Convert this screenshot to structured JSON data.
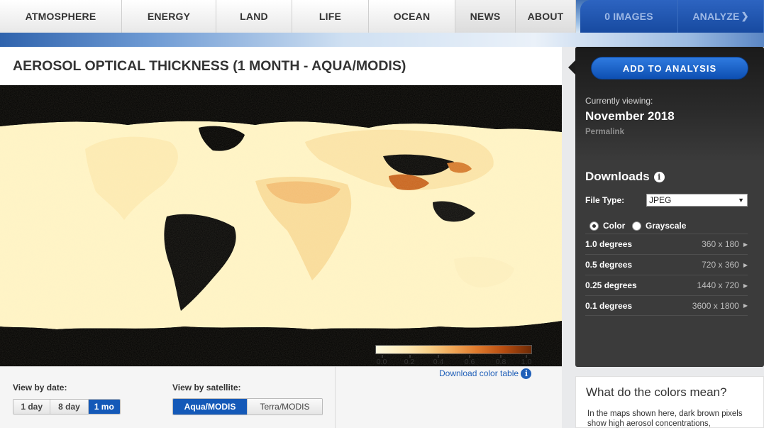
{
  "nav": {
    "tabs": [
      {
        "label": "ATMOSPHERE"
      },
      {
        "label": "ENERGY"
      },
      {
        "label": "LAND"
      },
      {
        "label": "LIFE"
      },
      {
        "label": "OCEAN"
      },
      {
        "label": "NEWS"
      },
      {
        "label": "ABOUT"
      },
      {
        "label": "0 IMAGES"
      },
      {
        "label": "ANALYZE"
      }
    ]
  },
  "main": {
    "title": "AEROSOL OPTICAL THICKNESS (1 MONTH - AQUA/MODIS)",
    "view_by_date_label": "View by date:",
    "date_buttons": [
      "1 day",
      "8 day",
      "1 mo"
    ],
    "date_selected": "1 mo",
    "view_by_satellite_label": "View by satellite:",
    "satellite_buttons": [
      "Aqua/MODIS",
      "Terra/MODIS"
    ],
    "satellite_selected": "Aqua/MODIS",
    "legend": {
      "ticks": [
        "0.0",
        "0.2",
        "0.4",
        "0.6",
        "0.8",
        "1.0"
      ],
      "colors": [
        "#fffbe0",
        "#fde9b5",
        "#f8cf86",
        "#f0a555",
        "#e07a2c",
        "#b84d10",
        "#6e2a05"
      ]
    },
    "download_color_table": "Download color table"
  },
  "sidebar": {
    "add_button": "ADD TO ANALYSIS",
    "currently_viewing_label": "Currently viewing:",
    "currently_viewing_value": "November 2018",
    "permalink": "Permalink",
    "downloads_title": "Downloads",
    "file_type_label": "File Type:",
    "file_type_value": "JPEG",
    "color_option": "Color",
    "grayscale_option": "Grayscale",
    "color_mode_selected": "Color",
    "resolutions": [
      {
        "name": "1.0 degrees",
        "size": "360 x 180"
      },
      {
        "name": "0.5 degrees",
        "size": "720 x 360"
      },
      {
        "name": "0.25 degrees",
        "size": "1440 x 720"
      },
      {
        "name": "0.1 degrees",
        "size": "3600 x 1800"
      }
    ]
  },
  "help": {
    "title": "What do the colors mean?",
    "body": "In the maps shown here, dark brown pixels show high aerosol concentrations,"
  },
  "colors": {
    "accent_blue": "#1459b8",
    "sidebar_bg": "#3b3b3b",
    "map_bg": "#000000"
  }
}
